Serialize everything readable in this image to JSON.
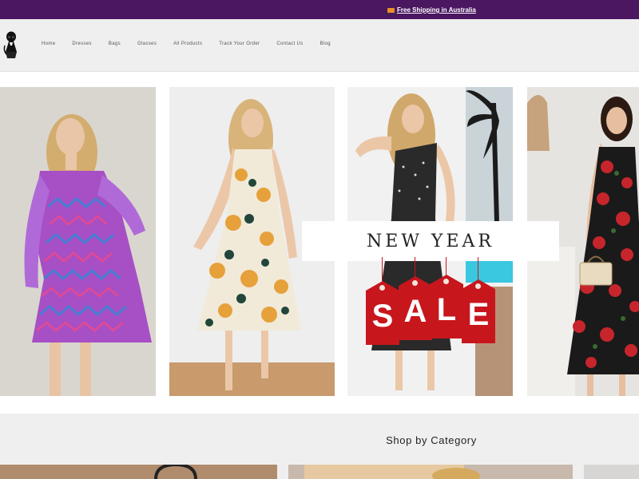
{
  "announcement": {
    "icon": "truck-icon",
    "text": "Free Shipping in Australia"
  },
  "header": {
    "logo": "logo-icon",
    "nav": [
      {
        "label": "Home"
      },
      {
        "label": "Dresses"
      },
      {
        "label": "Bags"
      },
      {
        "label": "Glasses"
      },
      {
        "label": "All Products"
      },
      {
        "label": "Track Your Order"
      },
      {
        "label": "Contact Us"
      },
      {
        "label": "Blog"
      }
    ]
  },
  "hero": {
    "banner_text": "NEW YEAR",
    "sale_letters": [
      "S",
      "A",
      "L",
      "E"
    ],
    "colors": {
      "sale_red": "#c8161d",
      "announcement_purple": "#4a1760"
    }
  },
  "category": {
    "title": "Shop by Category"
  }
}
